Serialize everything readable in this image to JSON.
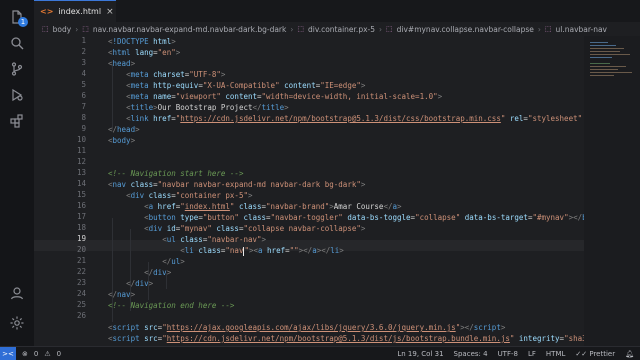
{
  "activity_bar": {
    "items": [
      {
        "name": "explorer-icon",
        "glyph": "files"
      },
      {
        "name": "search-icon",
        "glyph": "search"
      },
      {
        "name": "source-control-icon",
        "glyph": "branch"
      },
      {
        "name": "run-debug-icon",
        "glyph": "debug"
      },
      {
        "name": "extensions-icon",
        "glyph": "blocks"
      }
    ],
    "bottom_items": [
      {
        "name": "account-icon",
        "glyph": "person"
      },
      {
        "name": "settings-gear-icon",
        "glyph": "gear"
      }
    ],
    "explorer_badge": "1"
  },
  "tab": {
    "label": "index.html",
    "close_glyph": "×",
    "icon_glyph": "<>"
  },
  "breadcrumb": {
    "items": [
      "body",
      "nav.navbar.navbar-expand-md.navbar-dark.bg-dark",
      "div.container.px-5",
      "div#mynav.collapse.navbar-collapse",
      "ul.navbar-nav"
    ]
  },
  "editor": {
    "line_numbers": [
      "1",
      "2",
      "3",
      "4",
      "5",
      "6",
      "7",
      "8",
      "9",
      "10",
      "11",
      "12",
      "13",
      "14",
      "15",
      "16",
      "17",
      "18",
      "19",
      "20",
      "21",
      "22",
      "23",
      "24",
      "25",
      "26"
    ],
    "active_line_number": "19"
  },
  "status_bar": {
    "remote_glyph": "><",
    "errors": "0",
    "warnings": "0",
    "cursor_position": "Ln 19, Col 31",
    "spaces": "Spaces: 4",
    "encoding": "UTF-8",
    "eol": "LF",
    "language": "HTML",
    "formatter": "Prettier"
  },
  "colors": {
    "tag": "#569cd6",
    "attribute": "#9cdcfe",
    "string": "#ce9178",
    "comment": "#6a9955",
    "accent": "#3c78d8"
  }
}
